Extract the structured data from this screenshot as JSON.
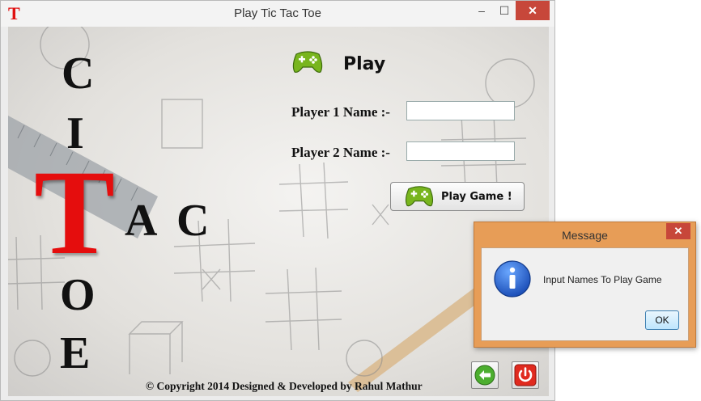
{
  "window": {
    "app_icon_letter": "T",
    "title": "Play Tic Tac Toe",
    "minimize": "–",
    "maximize": "☐",
    "close": "✕"
  },
  "logo": {
    "C": "C",
    "I": "I",
    "T": "T",
    "A": "A",
    "C2": "C",
    "O": "O",
    "E": "E"
  },
  "play": {
    "heading": "Play",
    "player1_label": "Player 1 Name :-",
    "player1_value": "",
    "player2_label": "Player 2 Name :-",
    "player2_value": "",
    "button_label": "Play Game !"
  },
  "footer": {
    "copyright": "© Copyright 2014 Designed & Developed by Rahul Mathur"
  },
  "icons": {
    "back": "back-arrow-icon",
    "power": "power-icon",
    "gamepad": "gamepad-icon",
    "info": "info-icon"
  },
  "dialog": {
    "title": "Message",
    "close": "✕",
    "message": "Input Names To Play Game",
    "ok_label": "OK"
  },
  "colors": {
    "title_T": "#e01010",
    "big_T": "#e50d0d",
    "dialog_frame": "#e79d57",
    "close_button": "#c7473a",
    "gamepad_green": "#78b51e"
  }
}
